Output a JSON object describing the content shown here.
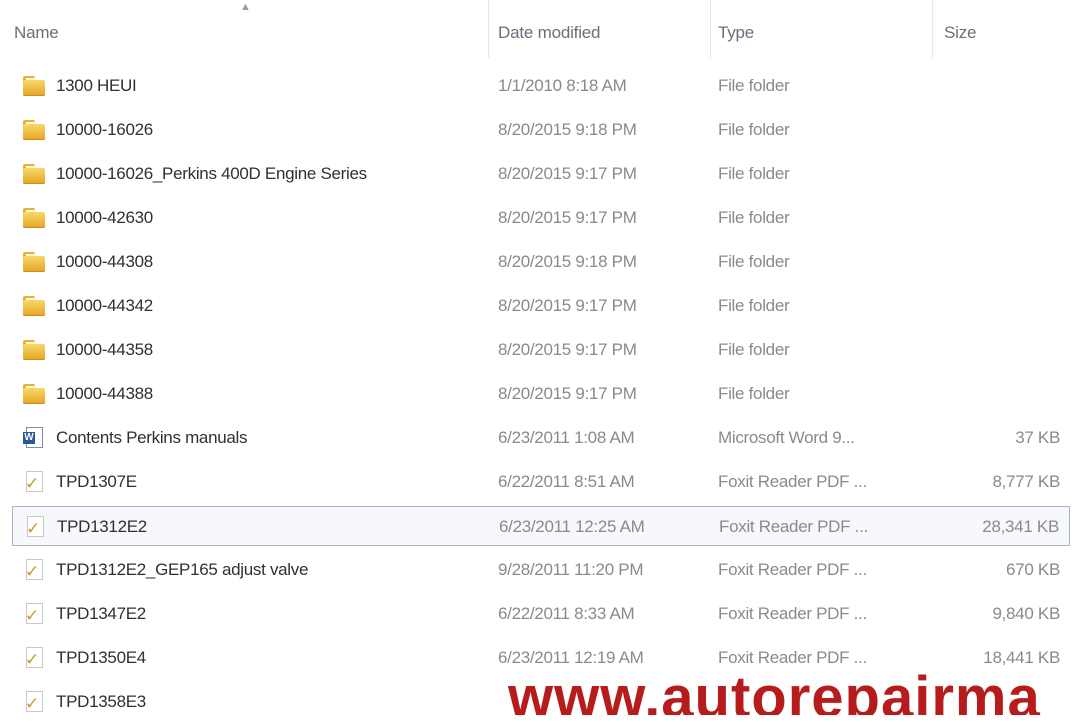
{
  "columns": {
    "name": "Name",
    "date": "Date modified",
    "type": "Type",
    "size": "Size"
  },
  "rows": [
    {
      "icon": "folder-icon",
      "name": "1300 HEUI",
      "date": "1/1/2010 8:18 AM",
      "type": "File folder",
      "size": ""
    },
    {
      "icon": "folder-icon",
      "name": "10000-16026",
      "date": "8/20/2015 9:18 PM",
      "type": "File folder",
      "size": ""
    },
    {
      "icon": "folder-icon",
      "name": "10000-16026_Perkins 400D Engine Series",
      "date": "8/20/2015 9:17 PM",
      "type": "File folder",
      "size": ""
    },
    {
      "icon": "folder-icon",
      "name": "10000-42630",
      "date": "8/20/2015 9:17 PM",
      "type": "File folder",
      "size": ""
    },
    {
      "icon": "folder-icon",
      "name": "10000-44308",
      "date": "8/20/2015 9:18 PM",
      "type": "File folder",
      "size": ""
    },
    {
      "icon": "folder-icon",
      "name": "10000-44342",
      "date": "8/20/2015 9:17 PM",
      "type": "File folder",
      "size": ""
    },
    {
      "icon": "folder-icon",
      "name": "10000-44358",
      "date": "8/20/2015 9:17 PM",
      "type": "File folder",
      "size": ""
    },
    {
      "icon": "folder-icon",
      "name": "10000-44388",
      "date": "8/20/2015 9:17 PM",
      "type": "File folder",
      "size": ""
    },
    {
      "icon": "word-document-icon",
      "name": "Contents Perkins manuals",
      "date": "6/23/2011 1:08 AM",
      "type": "Microsoft Word 9...",
      "size": "37 KB"
    },
    {
      "icon": "pdf-document-icon",
      "name": "TPD1307E",
      "date": "6/22/2011 8:51 AM",
      "type": "Foxit Reader PDF ...",
      "size": "8,777 KB"
    },
    {
      "icon": "pdf-document-icon",
      "name": "TPD1312E2",
      "date": "6/23/2011 12:25 AM",
      "type": "Foxit Reader PDF ...",
      "size": "28,341 KB",
      "selected": true
    },
    {
      "icon": "pdf-document-icon",
      "name": "TPD1312E2_GEP165 adjust valve",
      "date": "9/28/2011 11:20 PM",
      "type": "Foxit Reader PDF ...",
      "size": "670 KB"
    },
    {
      "icon": "pdf-document-icon",
      "name": "TPD1347E2",
      "date": "6/22/2011 8:33 AM",
      "type": "Foxit Reader PDF ...",
      "size": "9,840 KB"
    },
    {
      "icon": "pdf-document-icon",
      "name": "TPD1350E4",
      "date": "6/23/2011 12:19 AM",
      "type": "Foxit Reader PDF ...",
      "size": "18,441 KB"
    },
    {
      "icon": "pdf-document-icon",
      "name": "TPD1358E3",
      "date": "",
      "type": "",
      "size": ""
    }
  ],
  "watermark": "www.autorepairma",
  "colors": {
    "folder": "#e5a623",
    "selection_border": "#a8b6c8",
    "watermark": "#b71c1c"
  }
}
